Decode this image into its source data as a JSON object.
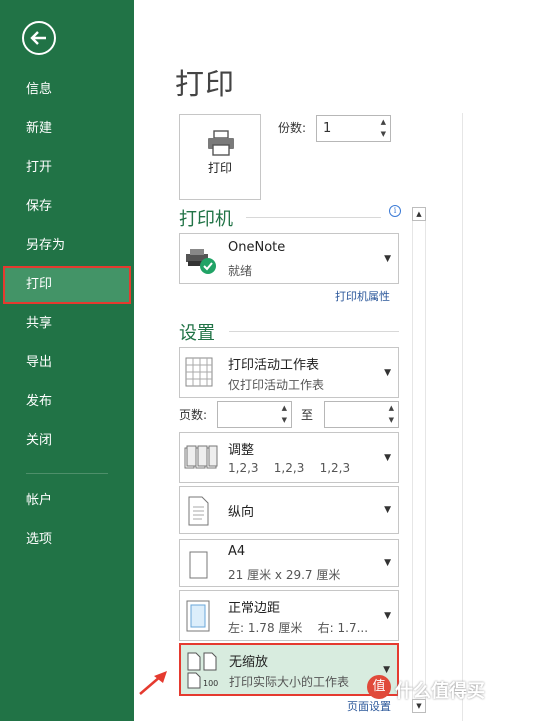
{
  "sidebar": {
    "items": [
      {
        "label": "信息"
      },
      {
        "label": "新建"
      },
      {
        "label": "打开"
      },
      {
        "label": "保存"
      },
      {
        "label": "另存为"
      },
      {
        "label": "打印"
      },
      {
        "label": "共享"
      },
      {
        "label": "导出"
      },
      {
        "label": "发布"
      },
      {
        "label": "关闭"
      },
      {
        "label": "帐户"
      },
      {
        "label": "选项"
      }
    ]
  },
  "main": {
    "title": "打印",
    "print_button_label": "打印",
    "copies_label": "份数:",
    "copies_value": "1",
    "printer_section_title": "打印机",
    "printer": {
      "name": "OneNote",
      "status": "就绪"
    },
    "printer_properties_link": "打印机属性",
    "settings_section_title": "设置",
    "settings": {
      "what_to_print": {
        "title": "打印活动工作表",
        "subtitle": "仅打印活动工作表"
      },
      "pages_label": "页数:",
      "to_label": "至",
      "collation": {
        "title": "调整",
        "subtitle": "1,2,3    1,2,3    1,2,3"
      },
      "orientation": {
        "title": "纵向"
      },
      "paper": {
        "title": "A4",
        "subtitle": "21 厘米 x 29.7 厘米"
      },
      "margins": {
        "title": "正常边距",
        "subtitle": "左: 1.78 厘米    右: 1.7..."
      },
      "scaling": {
        "title": "无缩放",
        "subtitle": "打印实际大小的工作表"
      }
    },
    "page_setup_link": "页面设置"
  },
  "watermark": {
    "text": "什么值得买",
    "logo": "值"
  },
  "colors": {
    "accent": "#217346",
    "highlight": "#e53a2f",
    "selected_bg": "#d8ecdf"
  }
}
